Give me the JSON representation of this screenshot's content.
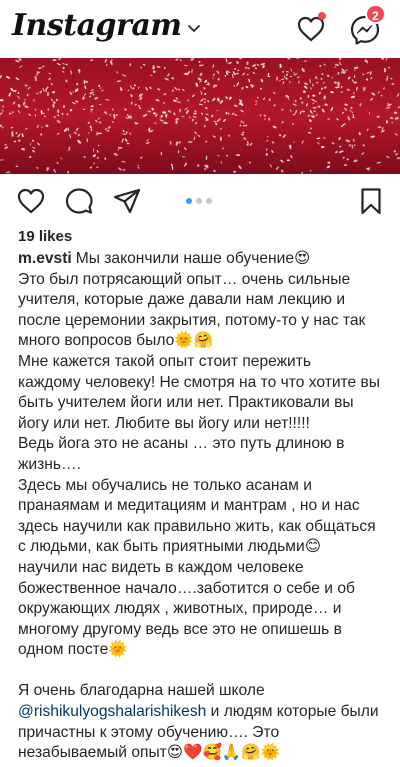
{
  "header": {
    "logo_text": "Instagram",
    "logo_icon": "chevron-down-icon",
    "activity_icon": "heart-icon",
    "messages_icon": "messenger-icon",
    "messages_badge": "2",
    "accent_color": "#ed4956"
  },
  "post": {
    "image_description_icon": "photo",
    "carousel": {
      "count": 3,
      "active": 1
    },
    "actions": {
      "like_icon": "heart-icon",
      "comment_icon": "comment-icon",
      "share_icon": "send-icon",
      "save_icon": "bookmark-icon"
    },
    "likes": "19 likes",
    "username": "m.evsti",
    "mention": "@rishikulyogshalarishikesh",
    "lines": [
      "Мы закончили наше обучение😍",
      "Это был потрясающий опыт… очень сильные",
      "учителя, которые даже давали нам лекцию и",
      "после церемонии закрытия, потому-то у нас так",
      "много вопросов было🌞🤗",
      "Мне кажется такой опыт стоит пережить",
      "каждому человеку! Не смотря на то что хотите вы",
      "быть учителем йоги или нет. Практиковали вы",
      "йогу или нет. Любите вы йогу или нет!!!!!",
      "Ведь йога это не асаны … это путь длиною в",
      "жизнь….",
      "Здесь мы обучались не только асанам и",
      "пранаямам и медитациям и мантрам , но и нас",
      "здесь научили как правильно жить, как общаться",
      "с людьми, как быть приятными людьми😊",
      "научили нас видеть в каждом человеке",
      "божественное начало….заботится о себе и об",
      "окружающих людях , животных, природе… и",
      "многому другому ведь все это не опишешь в",
      "одном посте🌞",
      "",
      "Я очень благодарна нашей школе",
      "и людям которые были",
      "причастны к этому обучению…. Это",
      "незабываемый опыт😍❤️🥰🙏🤗🌞"
    ]
  }
}
